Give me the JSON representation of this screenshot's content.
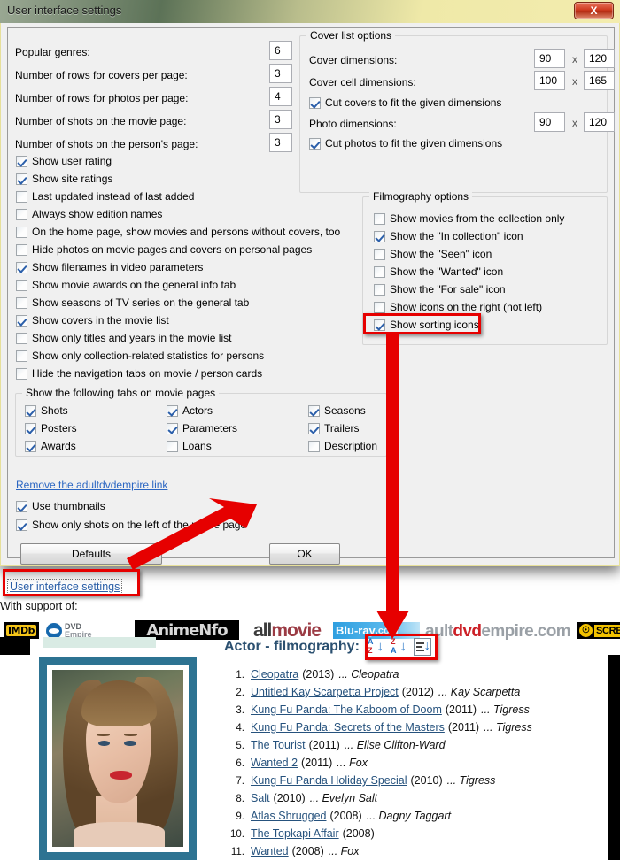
{
  "window": {
    "title": "User interface settings",
    "close_label": "X"
  },
  "left_panel": {
    "numeric_settings": [
      {
        "label": "Popular genres:",
        "value": "6"
      },
      {
        "label": "Number of rows for covers per page:",
        "value": "3"
      },
      {
        "label": "Number of rows for photos per page:",
        "value": "4"
      },
      {
        "label": "Number of shots on the movie page:",
        "value": "3"
      },
      {
        "label": "Number of shots on the person's page:",
        "value": "3"
      }
    ],
    "checkboxes": [
      {
        "label": "Show user rating",
        "checked": true
      },
      {
        "label": "Show site ratings",
        "checked": true
      },
      {
        "label": "Last updated instead of last added",
        "checked": false
      },
      {
        "label": "Always show edition names",
        "checked": false
      },
      {
        "label": "On the home page, show movies and persons without covers, too",
        "checked": false
      },
      {
        "label": "Hide photos on movie pages and covers on personal pages",
        "checked": false
      },
      {
        "label": "Show filenames in video parameters",
        "checked": true
      },
      {
        "label": "Show movie awards on the general info tab",
        "checked": false
      },
      {
        "label": "Show seasons of TV series on the general tab",
        "checked": false
      },
      {
        "label": "Show covers in the movie list",
        "checked": true
      },
      {
        "label": "Show only titles and years in the movie list",
        "checked": false
      },
      {
        "label": "Show only collection-related statistics for persons",
        "checked": false
      },
      {
        "label": "Hide the navigation tabs on movie / person cards",
        "checked": false
      }
    ]
  },
  "tabs_group": {
    "caption": "Show the following tabs on movie pages",
    "column1": [
      {
        "label": "Shots",
        "checked": true
      },
      {
        "label": "Posters",
        "checked": true
      },
      {
        "label": "Awards",
        "checked": true
      }
    ],
    "column2": [
      {
        "label": "Actors",
        "checked": true
      },
      {
        "label": "Parameters",
        "checked": true
      },
      {
        "label": "Loans",
        "checked": false
      }
    ],
    "column3": [
      {
        "label": "Seasons",
        "checked": true
      },
      {
        "label": "Trailers",
        "checked": true
      },
      {
        "label": "Description",
        "checked": false
      }
    ]
  },
  "bottom_left": {
    "remove_link": "Remove the adultdvdempire link",
    "checkboxes": [
      {
        "label": "Use thumbnails",
        "checked": true
      },
      {
        "label": "Show only shots on the left of the movie page",
        "checked": true
      }
    ],
    "defaults_button": "Defaults",
    "ok_button": "OK"
  },
  "cover_list_options": {
    "caption": "Cover list options",
    "rows": [
      {
        "label": "Cover dimensions:",
        "w": "90",
        "sep": "x",
        "h": "120"
      },
      {
        "label": "Cover cell dimensions:",
        "w": "100",
        "sep": "x",
        "h": "165"
      }
    ],
    "cut_covers": {
      "label": "Cut covers to fit the given dimensions",
      "checked": true
    },
    "photo_row": {
      "label": "Photo dimensions:",
      "w": "90",
      "sep": "x",
      "h": "120"
    },
    "cut_photos": {
      "label": "Cut photos to fit the given dimensions",
      "checked": true
    }
  },
  "filmography_options": {
    "caption": "Filmography options",
    "checkboxes": [
      {
        "label": "Show movies from the collection only",
        "checked": false
      },
      {
        "label": "Show the \"In collection\" icon",
        "checked": true
      },
      {
        "label": "Show the \"Seen\" icon",
        "checked": false
      },
      {
        "label": "Show the \"Wanted\" icon",
        "checked": false
      },
      {
        "label": "Show the \"For sale\" icon",
        "checked": false
      },
      {
        "label": "Show icons on the right (not left)",
        "checked": false
      },
      {
        "label": "Show sorting icons",
        "checked": true
      }
    ],
    "highlighted_option": "Show sorting icons"
  },
  "webpage": {
    "settings_link": "User interface settings",
    "support_label": "With support of:",
    "logos": [
      {
        "name": "imdb-logo",
        "text": "IMDb"
      },
      {
        "name": "dvdempire-logo",
        "text": "DVD Empire"
      },
      {
        "name": "animenfo-logo",
        "text": "AnimeNfo"
      },
      {
        "name": "allmovie-logo",
        "text_a": "all",
        "text_b": "movie"
      },
      {
        "name": "bluray-logo",
        "text_a": "Blu-ray",
        "text_b": ".com"
      },
      {
        "name": "adultdvdempire-logo",
        "t1": "a",
        "t2": "ult",
        "t3": "dvd",
        "t4": "empire.com"
      },
      {
        "name": "screen-logo",
        "text": "SCREEN"
      }
    ],
    "filmography_heading": "Actor - filmography:",
    "sort_icons": [
      {
        "name": "sort-a-z-icon",
        "top": "A",
        "bottom": "Z",
        "arrow": "↓"
      },
      {
        "name": "sort-z-a-icon",
        "top": "Z",
        "bottom": "A",
        "arrow": "↓"
      },
      {
        "name": "sort-list-icon",
        "arrow": "↓"
      }
    ],
    "filmography": [
      {
        "num": "1.",
        "title": "Cleopatra",
        "year": "(2013)",
        "role": "... Cleopatra"
      },
      {
        "num": "2.",
        "title": "Untitled Kay Scarpetta Project",
        "year": "(2012)",
        "role": "... Kay Scarpetta"
      },
      {
        "num": "3.",
        "title": "Kung Fu Panda: The Kaboom of Doom",
        "year": "(2011)",
        "role": "... Tigress"
      },
      {
        "num": "4.",
        "title": "Kung Fu Panda: Secrets of the Masters",
        "year": "(2011)",
        "role": "... Tigress"
      },
      {
        "num": "5.",
        "title": "The Tourist",
        "year": "(2011)",
        "role": "... Elise Clifton-Ward"
      },
      {
        "num": "6.",
        "title": "Wanted 2",
        "year": "(2011)",
        "role": "... Fox"
      },
      {
        "num": "7.",
        "title": "Kung Fu Panda Holiday Special",
        "year": "(2010)",
        "role": "... Tigress"
      },
      {
        "num": "8.",
        "title": "Salt",
        "year": "(2010)",
        "role": "... Evelyn Salt"
      },
      {
        "num": "9.",
        "title": "Atlas Shrugged",
        "year": "(2008)",
        "role": "... Dagny Taggart"
      },
      {
        "num": "10.",
        "title": "The Topkapi Affair",
        "year": "(2008)",
        "role": ""
      },
      {
        "num": "11.",
        "title": "Wanted",
        "year": "(2008)",
        "role": "... Fox"
      }
    ]
  },
  "annotations": {
    "highlight_color": "#e60000",
    "arrow_color": "#e60000"
  }
}
